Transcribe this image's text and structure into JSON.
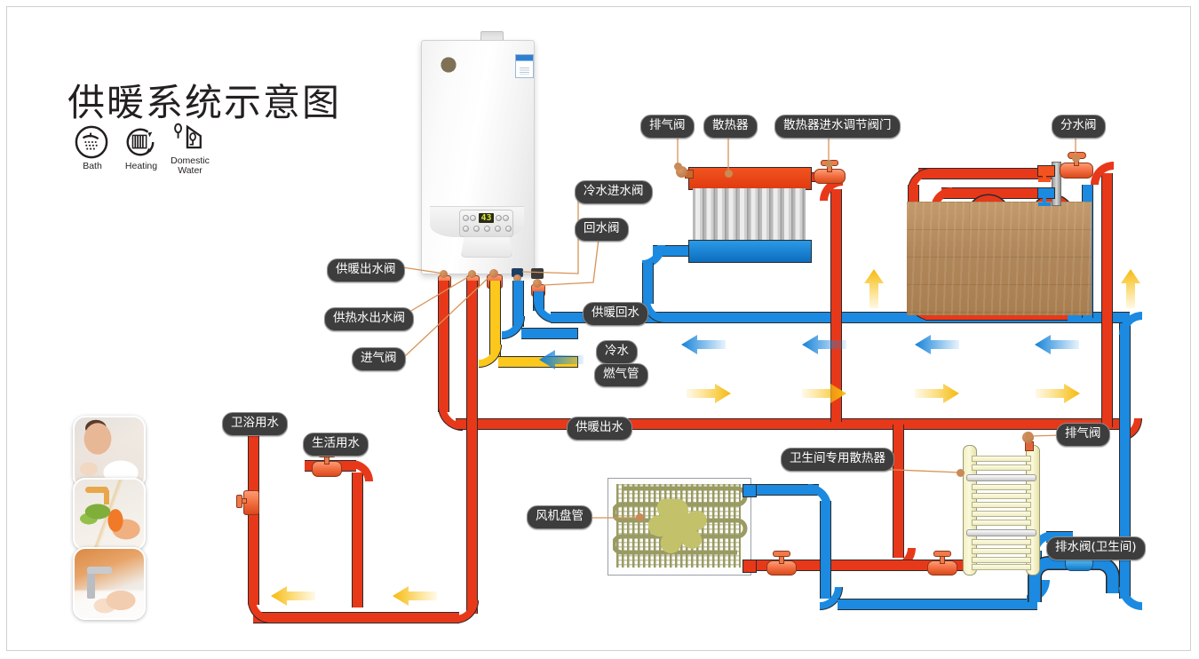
{
  "title": "供暖系统示意图",
  "modes": [
    {
      "name": "bath-mode-icon",
      "caption": "Bath"
    },
    {
      "name": "heating-mode-icon",
      "caption": "Heating"
    },
    {
      "name": "domestic-water-mode-icon",
      "caption": "Domestic\nWater"
    }
  ],
  "boiler": {
    "display_value": "43",
    "name": "wall-hung-gas-boiler"
  },
  "labels": {
    "cold_water_inlet_valve": "冷水进水阀",
    "return_water_valve": "回水阀",
    "heating_outlet_valve": "供暖出水阀",
    "hot_water_outlet_valve": "供热水出水阀",
    "gas_inlet_valve": "进气阀",
    "heating_return": "供暖回水",
    "cold_water": "冷水",
    "gas_pipe": "燃气管",
    "heating_supply": "供暖出水",
    "air_vent_radiator": "排气阀",
    "radiator": "散热器",
    "radiator_inlet_control_valve": "散热器进水调节阀门",
    "water_separator_valve": "分水阀",
    "bathroom_water": "卫浴用水",
    "domestic_water": "生活用水",
    "fan_coil_unit": "风机盘管",
    "bathroom_dedicated_radiator": "卫生间专用散热器",
    "air_vent_towel": "排气阀",
    "drain_valve_bathroom": "排水阀(卫生间)"
  },
  "photos": [
    {
      "name": "photo-bathing",
      "alt": "woman bathing"
    },
    {
      "name": "photo-washing-vegetables",
      "alt": "washing vegetables at sink"
    },
    {
      "name": "photo-washing-hands",
      "alt": "washing hands at faucet"
    }
  ],
  "colors": {
    "supply_red": "#e8381a",
    "return_blue": "#1b8ae0",
    "gas_yellow": "#fcc81c",
    "label_pill": "#3d3d3d",
    "leader_line": "#d79356",
    "arrow_yellow": "#fcc81c",
    "arrow_blue": "#1b8ae0",
    "wood_floor": "#b0875a",
    "fan_coil_green": "#9a9b63",
    "towel_cream": "#f5f2ce"
  }
}
